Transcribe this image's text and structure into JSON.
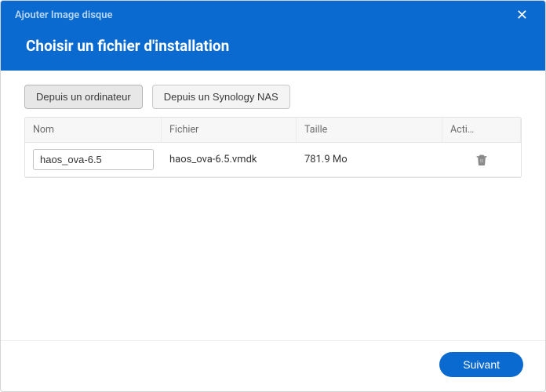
{
  "colors": {
    "primary": "#0a6acf"
  },
  "header": {
    "window_title": "Ajouter Image disque",
    "page_title": "Choisir un fichier d'installation"
  },
  "tabs": {
    "from_computer": "Depuis un ordinateur",
    "from_nas": "Depuis un Synology NAS",
    "active": "from_computer"
  },
  "table": {
    "columns": {
      "name": "Nom",
      "file": "Fichier",
      "size": "Taille",
      "actions": "Acti…"
    },
    "rows": [
      {
        "name": "haos_ova-6.5",
        "file": "haos_ova-6.5.vmdk",
        "size": "781.9 Mo"
      }
    ]
  },
  "footer": {
    "next": "Suivant"
  },
  "icons": {
    "close": "close-icon",
    "trash": "trash-icon"
  }
}
